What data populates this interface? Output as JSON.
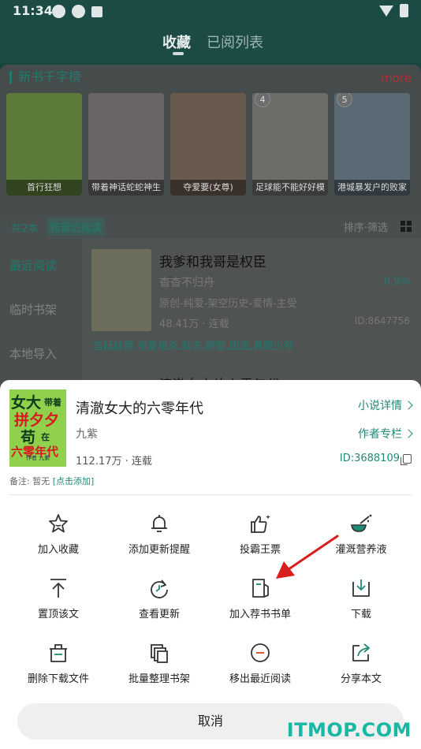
{
  "status_bar": {
    "time": "11:34"
  },
  "top_tabs": [
    {
      "label": "收藏",
      "active": true
    },
    {
      "label": "已阅列表",
      "active": false
    }
  ],
  "ranking": {
    "title": "新书千字榜",
    "more": "more",
    "books": [
      {
        "rank": "",
        "caption": "首行狂想"
      },
      {
        "rank": "",
        "caption": "带着神话蛇蛇神生"
      },
      {
        "rank": "",
        "caption": "夺爱要(女尊)"
      },
      {
        "rank": "4",
        "caption": "足球能不能好好模"
      },
      {
        "rank": "5",
        "caption": "港城暴发户的败家"
      }
    ]
  },
  "shelf_bar": {
    "count": "共2本",
    "order": "按最近阅读",
    "sort": "排序·筛选"
  },
  "shelf_side": [
    "最近阅读",
    "临时书架",
    "本地导入"
  ],
  "shelf_book": {
    "title": "我爹和我哥是权臣",
    "author": "杳杳不归舟",
    "progress": "0.9%",
    "tags": "原创-纯爱-架空历史-爱情-主受",
    "words": "48.41万 · 连载",
    "id": "ID:8647756",
    "keywords": "宫廷侯爵,相爱相杀,励志,朝堂,团宠,真假少爷",
    "next_title": "清澈女大的六零年代"
  },
  "sheet": {
    "cover": {
      "line1a": "女大",
      "line1b": "带着",
      "line2": "拼夕夕",
      "line3a": "苟",
      "line3b": "在",
      "line4": "六零年代",
      "author": "作者 九紫"
    },
    "title": "清澈女大的六零年代",
    "author": "九紫",
    "words": "112.17万 · 连载",
    "novel_detail": "小说详情",
    "author_column": "作者专栏",
    "id": "ID:3688109",
    "note_label": "备注: 暂无",
    "note_add": "[点击添加]",
    "actions": [
      {
        "label": "加入收藏",
        "icon": "star-icon"
      },
      {
        "label": "添加更新提醒",
        "icon": "bell-icon"
      },
      {
        "label": "投霸王票",
        "icon": "thumbs-up-icon"
      },
      {
        "label": "灌溉营养液",
        "icon": "watering-icon"
      },
      {
        "label": "置顶该文",
        "icon": "pin-top-icon"
      },
      {
        "label": "查看更新",
        "icon": "refresh-icon"
      },
      {
        "label": "加入荐书书单",
        "icon": "booklist-icon"
      },
      {
        "label": "下载",
        "icon": "download-icon"
      },
      {
        "label": "删除下载文件",
        "icon": "delete-download-icon"
      },
      {
        "label": "批量整理书架",
        "icon": "batch-shelf-icon"
      },
      {
        "label": "移出最近阅读",
        "icon": "remove-circle-icon"
      },
      {
        "label": "分享本文",
        "icon": "share-icon"
      }
    ],
    "cancel": "取消"
  },
  "watermark": "ITMOP.COM",
  "colors": {
    "accent": "#1f8a78",
    "arrow": "#d81e1e",
    "overlay": "#1c4a45"
  }
}
